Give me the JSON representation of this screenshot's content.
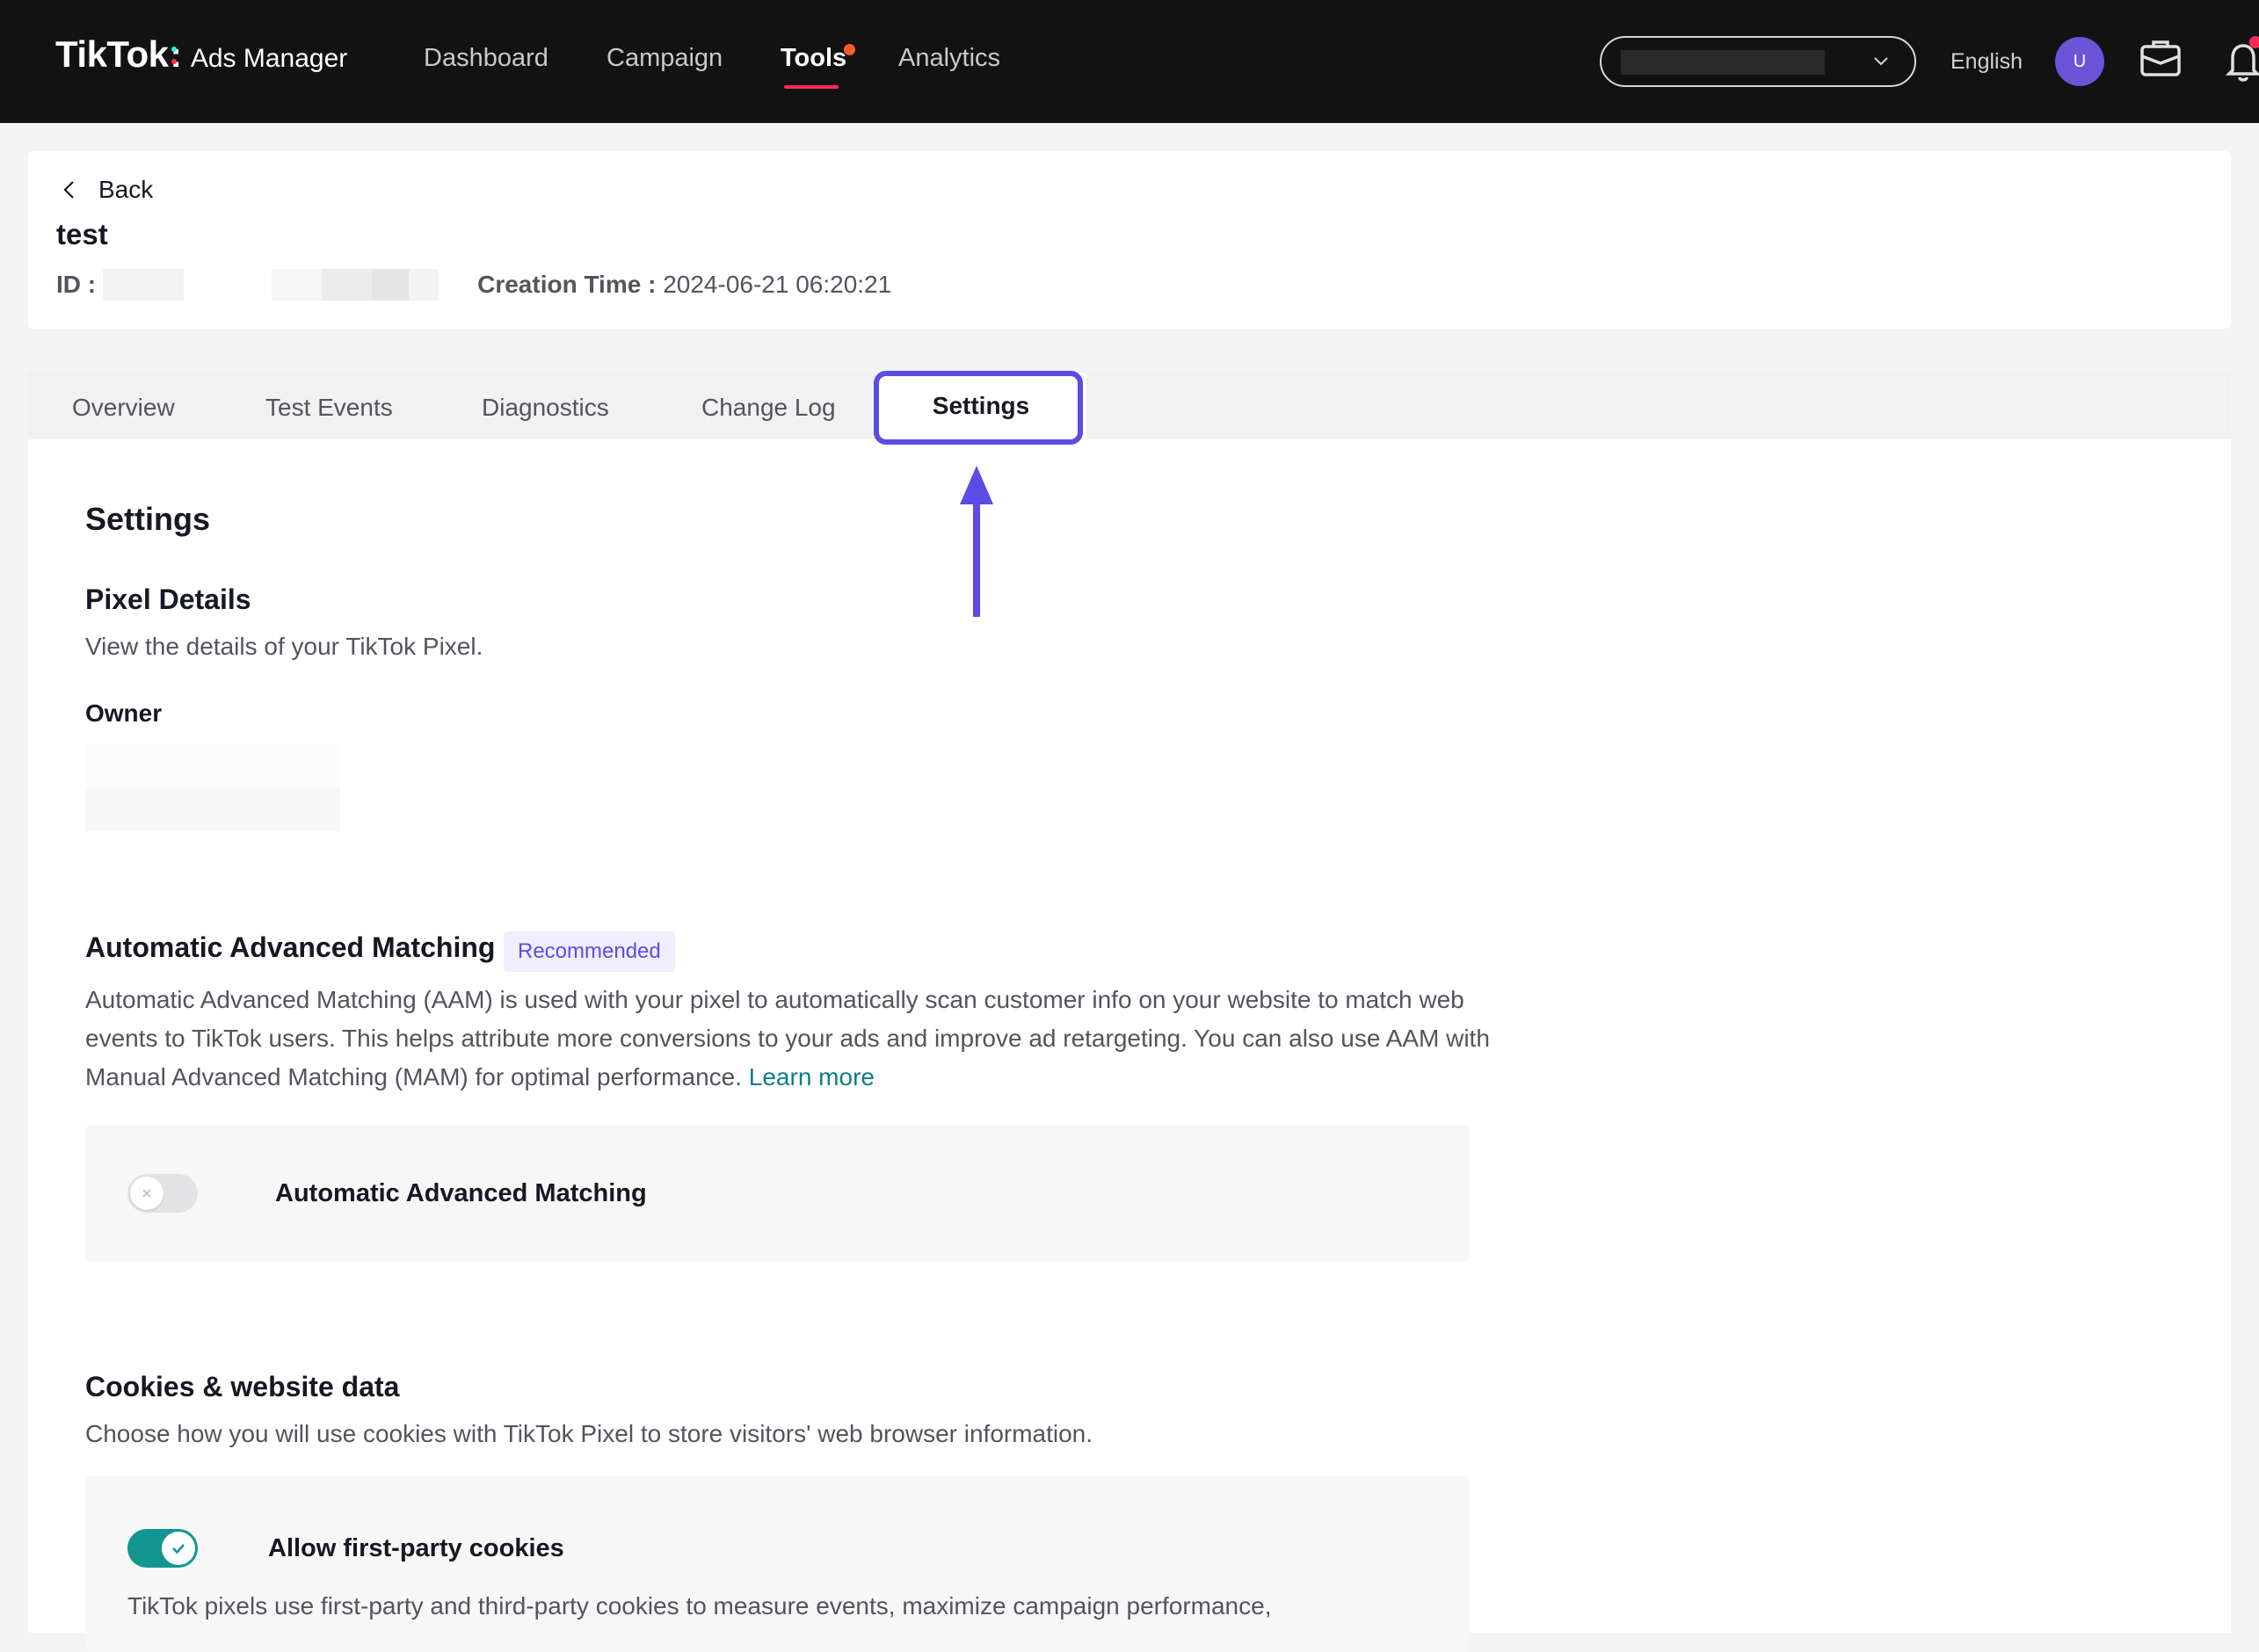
{
  "topbar": {
    "brand": "TikTok",
    "product": "Ads Manager",
    "nav": {
      "dashboard": "Dashboard",
      "campaign": "Campaign",
      "tools": "Tools",
      "analytics": "Analytics"
    },
    "language": "English",
    "avatar_initial": "U"
  },
  "header": {
    "back_label": "Back",
    "pixel_name": "test",
    "id_label": "ID :",
    "creation_label": "Creation Time :",
    "creation_value": "2024-06-21 06:20:21"
  },
  "tabs": {
    "overview": "Overview",
    "test_events": "Test Events",
    "diagnostics": "Diagnostics",
    "change_log": "Change Log",
    "settings": "Settings",
    "active": "Settings"
  },
  "settings": {
    "title": "Settings",
    "pixel_details": {
      "heading": "Pixel Details",
      "description": "View the details of your TikTok Pixel.",
      "owner_label": "Owner"
    },
    "aam": {
      "heading": "Automatic Advanced Matching",
      "badge": "Recommended",
      "description": "Automatic Advanced Matching (AAM) is used with your pixel to automatically scan customer info on your website to match web events to TikTok users. This helps attribute more conversions to your ads and improve ad retargeting. You can also use AAM with Manual Advanced Matching (MAM) for optimal performance.",
      "learn_more": "Learn more",
      "toggle_label": "Automatic Advanced Matching",
      "enabled": false
    },
    "cookies": {
      "heading": "Cookies & website data",
      "description": "Choose how you will use cookies with TikTok Pixel to store visitors' web browser information.",
      "toggle_label": "Allow first-party cookies",
      "enabled": true,
      "body": "TikTok pixels use first-party and third-party cookies to measure events, maximize campaign performance,"
    }
  },
  "colors": {
    "topbar_bg": "#121212",
    "accent_red": "#fe2c55",
    "annotation_purple": "#5b4ce6",
    "toggle_on": "#12968f",
    "link": "#0e7e86"
  },
  "icons": [
    "chevron-left-icon",
    "chevron-down-icon",
    "briefcase-icon",
    "bell-icon",
    "check-icon",
    "x-icon",
    "arrow-up-icon"
  ]
}
